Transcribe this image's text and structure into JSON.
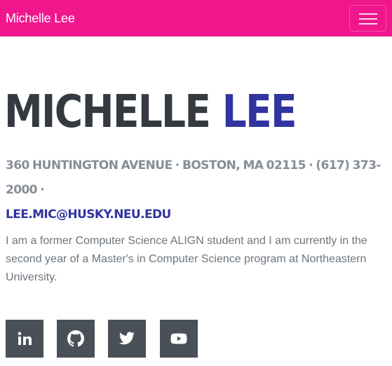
{
  "navbar": {
    "brand": "Michelle Lee",
    "menu_icon": "hamburger-menu-icon"
  },
  "hero": {
    "first_name": "Michelle",
    "last_name": "Lee",
    "address": "360 Huntington Avenue · Boston, MA 02115 · (617) 373-2000 ·",
    "email": "lee.mic@husky.neu.edu",
    "bio": "I am a former Computer Science ALIGN student and I am currently in the second year of a Master's in Computer Science program at Northeastern University."
  },
  "social": [
    {
      "name": "linkedin",
      "icon": "linkedin-icon"
    },
    {
      "name": "github",
      "icon": "github-icon"
    },
    {
      "name": "twitter",
      "icon": "twitter-icon"
    },
    {
      "name": "youtube",
      "icon": "youtube-icon"
    }
  ],
  "colors": {
    "navbar_bg": "#f0168c",
    "name_dark": "#343a40",
    "accent": "#3134a0",
    "muted": "#868e96",
    "social_bg": "#495057"
  }
}
